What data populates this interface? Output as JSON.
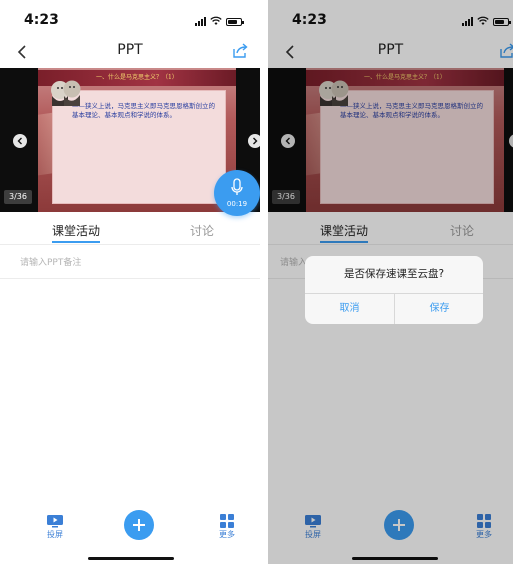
{
  "status_bar": {
    "time": "4:23"
  },
  "nav": {
    "title": "PPT"
  },
  "slide": {
    "title": "一、什么是马克思主义？（1）",
    "body": "——狭义上说，马克思主义即马克思恩格斯创立的基本理论、基本观点和学说的体系。",
    "counter": "3/36"
  },
  "recording": {
    "time": "00:19"
  },
  "tabs": [
    {
      "label": "课堂活动"
    },
    {
      "label": "讨论"
    }
  ],
  "note": {
    "placeholder": "请输入PPT备注"
  },
  "bottom_bar": {
    "cast_label": "投屏",
    "more_label": "更多"
  },
  "dialog": {
    "message": "是否保存速课至云盘?",
    "cancel_label": "取消",
    "save_label": "保存"
  },
  "colors": {
    "accent": "#3b9cf0",
    "slide_text": "#2a3fa0",
    "overlay": "#000000"
  }
}
